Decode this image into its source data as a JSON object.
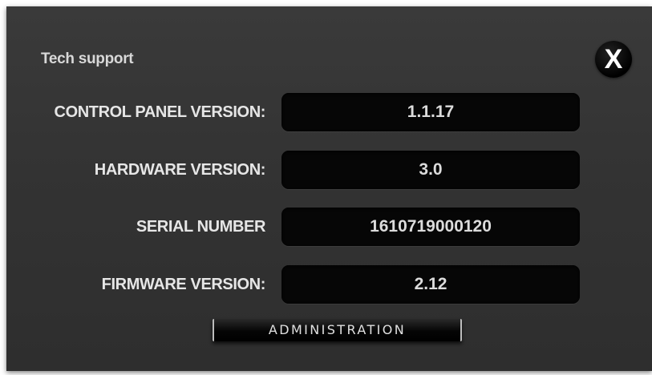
{
  "dialog": {
    "title": "Tech support",
    "close_label": "X"
  },
  "fields": [
    {
      "label": "CONTROL PANEL VERSION:",
      "value": "1.1.17"
    },
    {
      "label": "HARDWARE VERSION:",
      "value": "3.0"
    },
    {
      "label": "SERIAL NUMBER",
      "value": "1610719000120"
    },
    {
      "label": "FIRMWARE VERSION:",
      "value": "2.12"
    }
  ],
  "actions": {
    "administration_label": "ADMINISTRATION"
  },
  "colors": {
    "panel_background": "#333333",
    "field_background": "#060606",
    "text": "#e6e6e6"
  }
}
